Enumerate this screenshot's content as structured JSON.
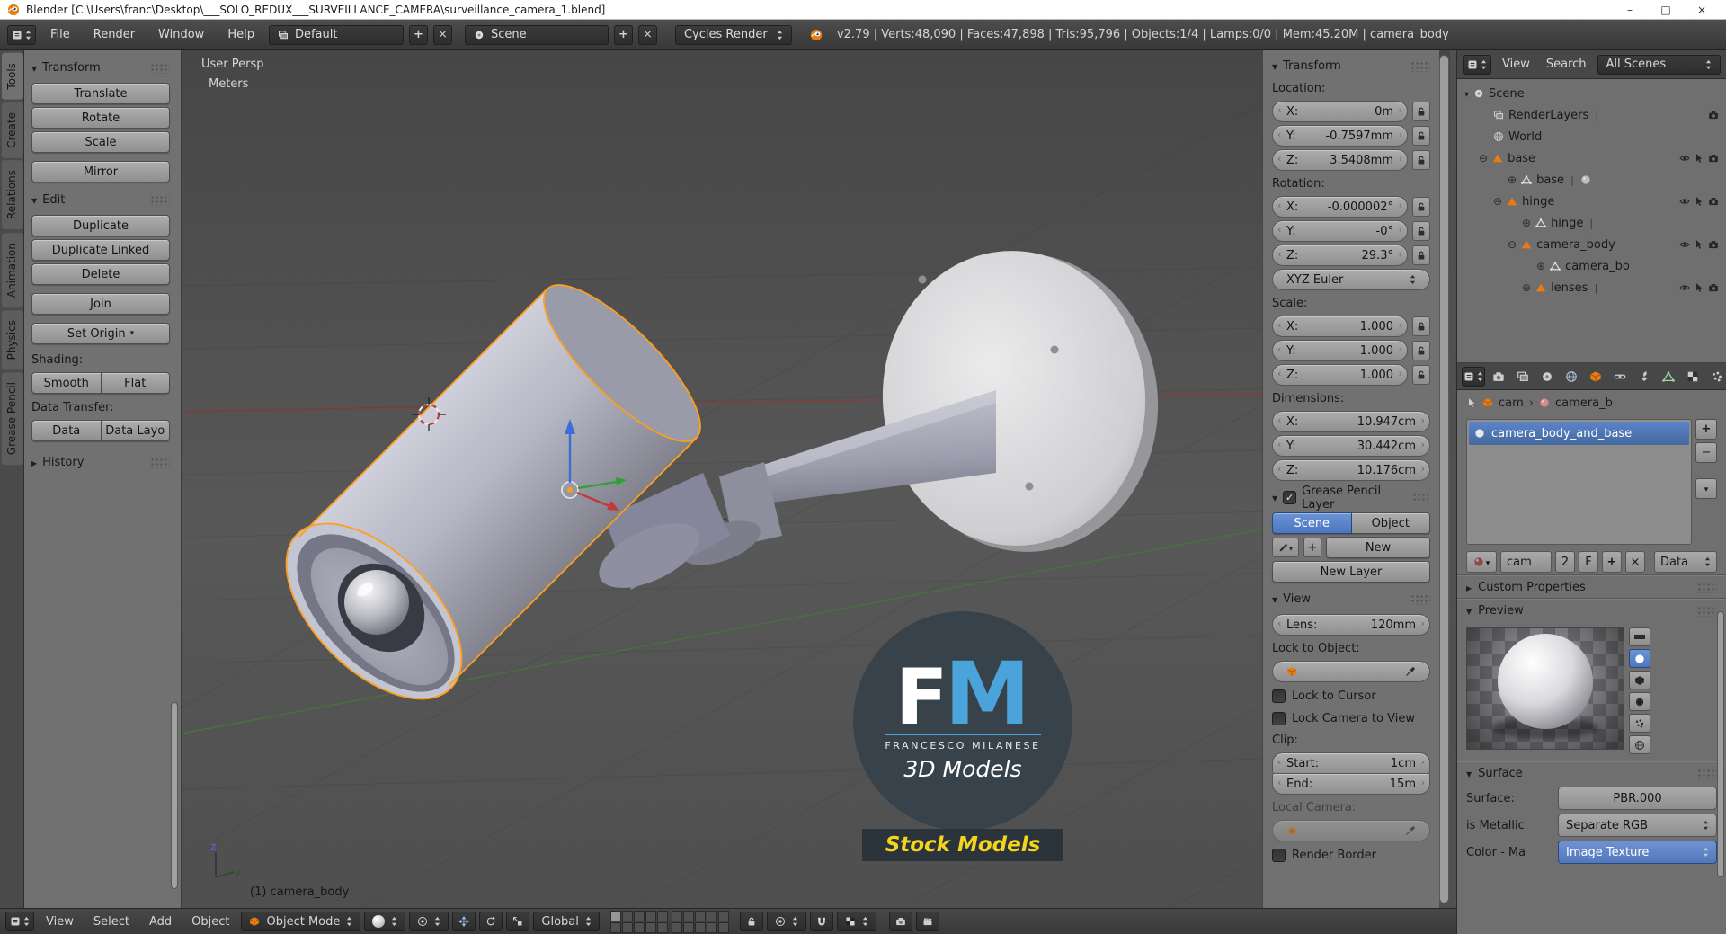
{
  "window": {
    "title": "Blender [C:\\Users\\franc\\Desktop\\___SOLO_REDUX___SURVEILLANCE_CAMERA\\surveillance_camera_1.blend]",
    "minimize": "–",
    "maximize": "□",
    "close": "×"
  },
  "info_header": {
    "menus": [
      "File",
      "Render",
      "Window",
      "Help"
    ],
    "layout": "Default",
    "scene": "Scene",
    "engine": "Cycles Render",
    "stats": "v2.79 | Verts:48,090 | Faces:47,898 | Tris:95,796 | Objects:1/4 | Lamps:0/0 | Mem:45.20M | camera_body"
  },
  "tool_tabs": [
    "Tools",
    "Create",
    "Relations",
    "Animation",
    "Physics",
    "Grease Pencil"
  ],
  "tool_shelf": {
    "transform_title": "Transform",
    "transform_buttons": [
      "Translate",
      "Rotate",
      "Scale",
      "Mirror"
    ],
    "edit_title": "Edit",
    "edit_buttons": [
      "Duplicate",
      "Duplicate Linked",
      "Delete",
      "Join"
    ],
    "set_origin": "Set Origin",
    "shading_label": "Shading:",
    "smooth": "Smooth",
    "flat": "Flat",
    "data_transfer_label": "Data Transfer:",
    "data": "Data",
    "data_layout": "Data Layo",
    "history_title": "History"
  },
  "viewport": {
    "view_label": "User Persp",
    "unit_label": "Meters",
    "object_label": "(1) camera_body",
    "axis_z": "z",
    "axis_y": "y",
    "watermark_f": "F",
    "watermark_m": "M",
    "watermark_name": "FRANCESCO MILANESE",
    "watermark_sub": "3D Models",
    "watermark_banner": "Stock Models"
  },
  "n_panel": {
    "transform_title": "Transform",
    "location_label": "Location:",
    "loc": [
      {
        "a": "X:",
        "v": "0m"
      },
      {
        "a": "Y:",
        "v": "-0.7597mm"
      },
      {
        "a": "Z:",
        "v": "3.5408mm"
      }
    ],
    "rotation_label": "Rotation:",
    "rot": [
      {
        "a": "X:",
        "v": "-0.000002°"
      },
      {
        "a": "Y:",
        "v": "-0°"
      },
      {
        "a": "Z:",
        "v": "29.3°"
      }
    ],
    "rotation_mode": "XYZ Euler",
    "scale_label": "Scale:",
    "scl": [
      {
        "a": "X:",
        "v": "1.000"
      },
      {
        "a": "Y:",
        "v": "1.000"
      },
      {
        "a": "Z:",
        "v": "1.000"
      }
    ],
    "dimensions_label": "Dimensions:",
    "dim": [
      {
        "a": "X:",
        "v": "10.947cm"
      },
      {
        "a": "Y:",
        "v": "30.442cm"
      },
      {
        "a": "Z:",
        "v": "10.176cm"
      }
    ],
    "gp_title": "Grease Pencil Layer",
    "gp_scene": "Scene",
    "gp_object": "Object",
    "gp_new": "New",
    "gp_new_layer": "New Layer",
    "view_title": "View",
    "lens_label": "Lens:",
    "lens_value": "120mm",
    "lock_to_object_label": "Lock to Object:",
    "lock_to_cursor": "Lock to Cursor",
    "lock_camera_to_view": "Lock Camera to View",
    "clip_label": "Clip:",
    "clip_start_label": "Start:",
    "clip_start_value": "1cm",
    "clip_end_label": "End:",
    "clip_end_value": "15m",
    "local_camera_label": "Local Camera:",
    "render_border": "Render Border"
  },
  "outliner": {
    "view_menu": "View",
    "search_menu": "Search",
    "display_mode": "All Scenes",
    "rows": [
      {
        "label": "Scene"
      },
      {
        "label": "RenderLayers"
      },
      {
        "label": "World"
      },
      {
        "label": "base"
      },
      {
        "label": "base"
      },
      {
        "label": "hinge"
      },
      {
        "label": "hinge"
      },
      {
        "label": "camera_body"
      },
      {
        "label": "camera_bo"
      },
      {
        "label": "lenses"
      }
    ]
  },
  "properties": {
    "crumb_object": "cam",
    "crumb_data": "camera_b",
    "slot_name": "camera_body_and_base",
    "db_name": "cam",
    "db_users": "2",
    "db_fake": "F",
    "db_link": "Data",
    "custom_title": "Custom Properties",
    "preview_title": "Preview",
    "surface_title": "Surface",
    "surface_label": "Surface:",
    "surface_value": "PBR.000",
    "metallic_label": "is Metallic",
    "metallic_value": "Separate RGB",
    "color_label": "Color - Ma",
    "color_value": "Image Texture"
  },
  "bottom_header": {
    "menus": [
      "View",
      "Select",
      "Add",
      "Object"
    ],
    "mode": "Object Mode",
    "orientation": "Global"
  },
  "colors": {
    "accent_blue": "#5680c2",
    "object_orange": "#e87c12",
    "select_outline": "#ff9e1b",
    "watermark_blue": "#4ba3dc",
    "banner_yellow": "#f4d41c"
  }
}
